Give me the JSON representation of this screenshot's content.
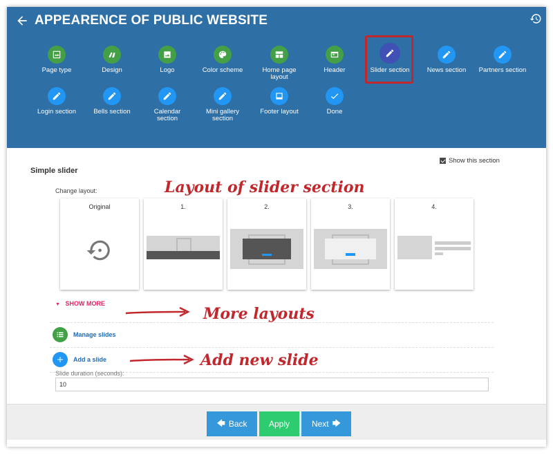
{
  "header": {
    "title": "APPEARENCE OF PUBLIC WEBSITE",
    "steps": [
      {
        "label": "Page type",
        "icon": "image-icon",
        "color": "#43a047"
      },
      {
        "label": "Design",
        "icon": "palette-icon",
        "color": "#43a047"
      },
      {
        "label": "Logo",
        "icon": "photo-icon",
        "color": "#43a047"
      },
      {
        "label": "Color scheme",
        "icon": "color-palette-icon",
        "color": "#43a047"
      },
      {
        "label": "Home page layout",
        "icon": "layout-icon",
        "color": "#43a047"
      },
      {
        "label": "Header",
        "icon": "header-icon",
        "color": "#43a047"
      },
      {
        "label": "Slider section",
        "icon": "pencil-icon",
        "color": "#3f51b5"
      },
      {
        "label": "News section",
        "icon": "pencil-icon",
        "color": "#2196f3"
      },
      {
        "label": "Partners section",
        "icon": "pencil-icon",
        "color": "#2196f3"
      },
      {
        "label": "Login section",
        "icon": "pencil-icon",
        "color": "#2196f3"
      },
      {
        "label": "Bells section",
        "icon": "pencil-icon",
        "color": "#2196f3"
      },
      {
        "label": "Calendar section",
        "icon": "pencil-icon",
        "color": "#2196f3"
      },
      {
        "label": "Mini gallery section",
        "icon": "pencil-icon",
        "color": "#2196f3"
      },
      {
        "label": "Footer layout",
        "icon": "footer-icon",
        "color": "#2196f3"
      },
      {
        "label": "Done",
        "icon": "check-icon",
        "color": "#2196f3"
      }
    ]
  },
  "section": {
    "title": "Simple slider",
    "show_label": "Show this section",
    "show_checked": true,
    "change_layout_label": "Change layout:",
    "layouts": [
      "Original",
      "1.",
      "2.",
      "3.",
      "4."
    ],
    "show_more": "SHOW MORE",
    "manage_slides": "Manage slides",
    "add_slide": "Add a slide",
    "duration_label": "Slide duration (seconds):",
    "duration_value": "10"
  },
  "annotations": {
    "layout": "Layout of slider section",
    "more": "More layouts",
    "add": "Add new slide"
  },
  "footer": {
    "back": "Back",
    "apply": "Apply",
    "next": "Next"
  },
  "colors": {
    "header_bg": "#2e6fa6",
    "apply": "#2ecc71",
    "nav_button": "#3498db",
    "highlight": "#c0282d",
    "show_more": "#e91e63"
  }
}
